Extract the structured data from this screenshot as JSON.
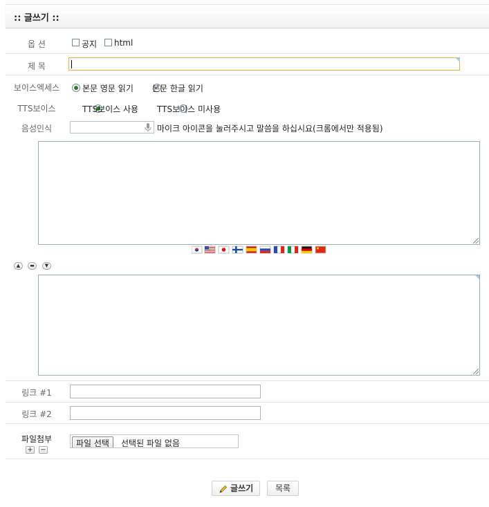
{
  "header": {
    "title": ":: 글쓰기 ::"
  },
  "options": {
    "label": "옵 션",
    "notice": {
      "label": "공지",
      "checked": false
    },
    "html": {
      "label": "html",
      "checked": false
    }
  },
  "subject": {
    "label": "제 목",
    "value": ""
  },
  "voice_access": {
    "label": "보이스엑세스",
    "choices": [
      {
        "label": "본문 영문 읽기",
        "selected": true
      },
      {
        "label": "본문 한글 읽기",
        "selected": false
      }
    ]
  },
  "tts_voice": {
    "label": "TTS보이스",
    "choices": [
      {
        "label": "TTS보이스 사용",
        "selected": true
      },
      {
        "label": "TTS보이스 미사용",
        "selected": false
      }
    ]
  },
  "speech": {
    "label": "음성인식",
    "value": "",
    "hint": "마이크 아이콘을 눌러주시고 말씀을 하십시요(크롬에서만 적용됨)"
  },
  "translate_flags": [
    "korea-flag",
    "usa-flag",
    "japan-flag",
    "finland-flag",
    "spain-flag",
    "russia-flag",
    "france-flag",
    "italy-flag",
    "germany-flag",
    "china-flag"
  ],
  "links": [
    {
      "label": "링크 #1",
      "value": ""
    },
    {
      "label": "링크 #2",
      "value": ""
    }
  ],
  "attach": {
    "label": "파일첨부",
    "choose_label": "파일 선택",
    "status": "선택된 파일 없음"
  },
  "actions": {
    "submit_label": "글쓰기",
    "list_label": "목록"
  }
}
